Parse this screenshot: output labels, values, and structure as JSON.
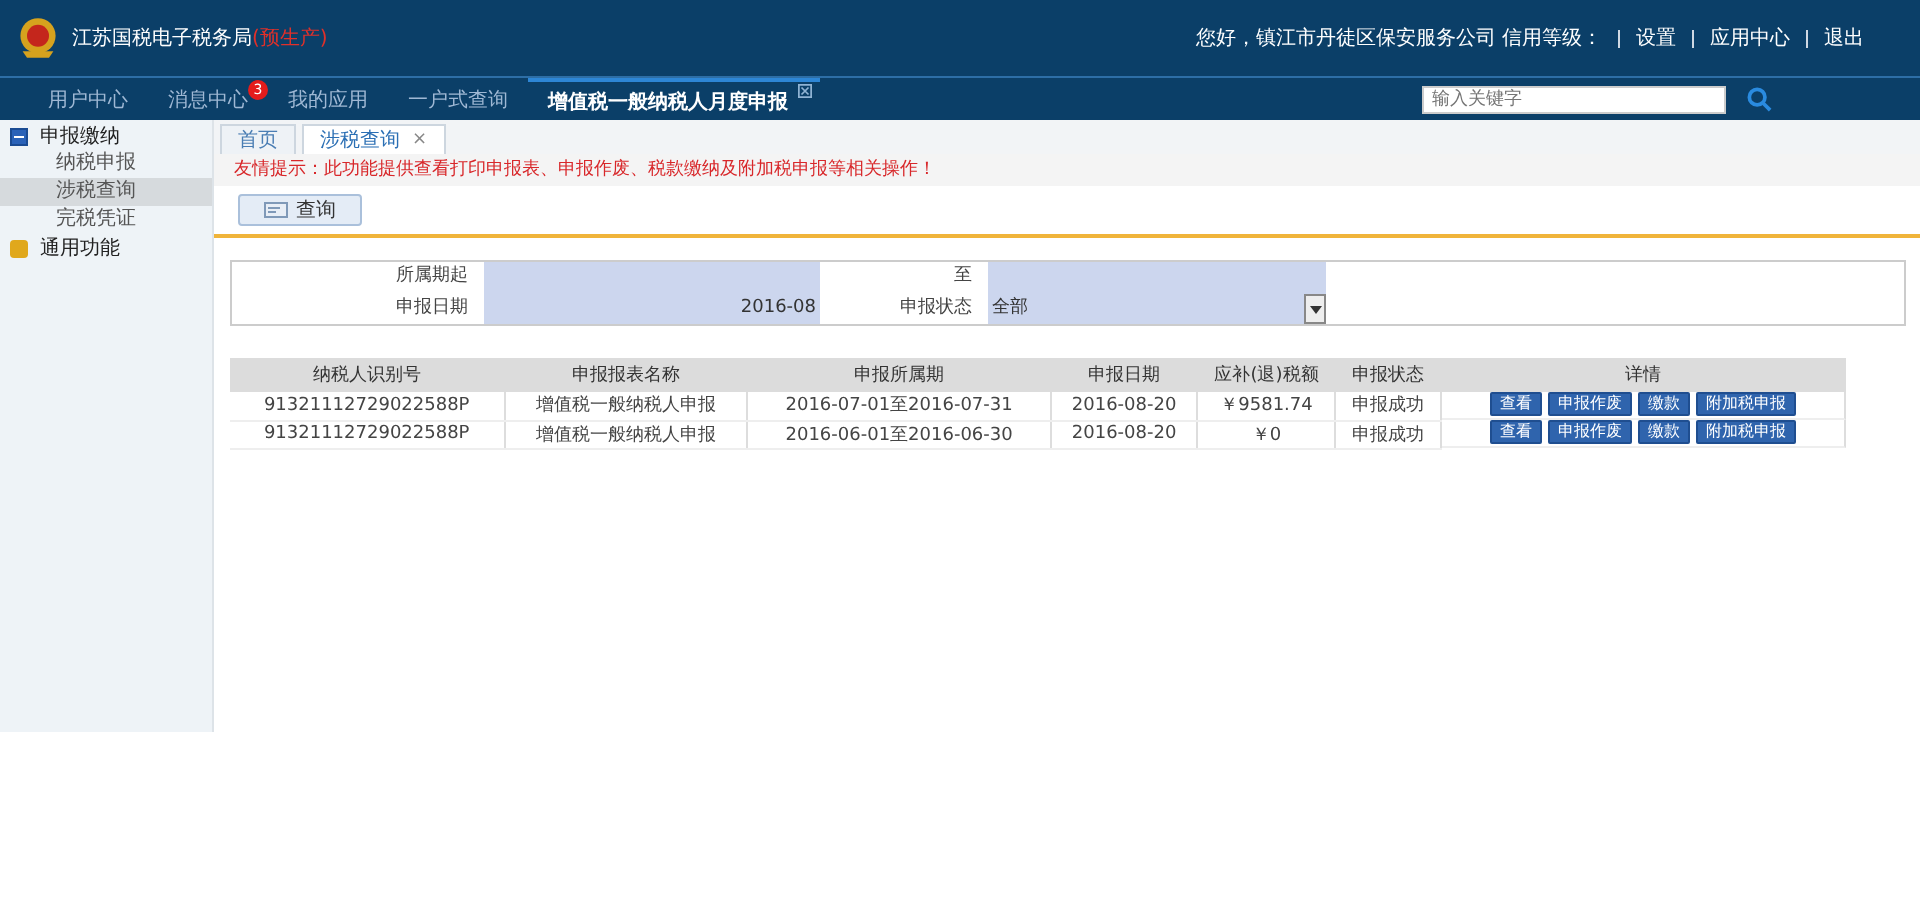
{
  "header": {
    "title": "江苏国税电子税务局",
    "title_suffix": "(预生产)",
    "greeting": "您好，镇江市丹徒区保安服务公司 信用等级：",
    "links": [
      "设置",
      "应用中心",
      "退出"
    ]
  },
  "nav": [
    {
      "label": "用户中心",
      "selected": false
    },
    {
      "label": "消息中心",
      "selected": false,
      "badge": "3"
    },
    {
      "label": "我的应用",
      "selected": false
    },
    {
      "label": "一户式查询",
      "selected": false
    },
    {
      "label": "增值税一般纳税人月度申报",
      "selected": true,
      "closable": true
    }
  ],
  "search": {
    "placeholder": "输入关键字"
  },
  "sidebar": {
    "items": [
      {
        "label": "申报缴纳",
        "expanded": true,
        "children": [
          {
            "label": "纳税申报",
            "selected": false
          },
          {
            "label": "涉税查询",
            "selected": true
          },
          {
            "label": "完税凭证",
            "selected": false
          }
        ]
      },
      {
        "label": "通用功能",
        "expanded": false
      }
    ]
  },
  "tabs": [
    {
      "label": "首页",
      "selected": false
    },
    {
      "label": "涉税查询",
      "selected": true,
      "close": "×"
    }
  ],
  "notice": "友情提示：此功能提供查看打印申报表、申报作废、税款缴纳及附加税申报等相关操作！",
  "query_button": "查询",
  "form": {
    "period_label": "所属期起",
    "to_label": "至",
    "date_label": "申报日期",
    "date_value": "2016-08",
    "status_label": "申报状态",
    "status_value": "全部"
  },
  "table": {
    "columns": [
      "纳税人识别号",
      "申报报表名称",
      "申报所属期",
      "申报日期",
      "应补(退)税额",
      "申报状态",
      "详情"
    ],
    "rows": [
      {
        "cells": [
          "91321112729022588P",
          "增值税一般纳税人申报",
          "2016-07-01至2016-07-31",
          "2016-08-20",
          "￥9581.74",
          "申报成功"
        ],
        "actions": [
          "查看",
          "申报作废",
          "缴款",
          "附加税申报"
        ]
      },
      {
        "cells": [
          "91321112729022588P",
          "增值税一般纳税人申报",
          "2016-06-01至2016-06-30",
          "2016-08-20",
          "￥0",
          "申报成功"
        ],
        "actions": [
          "查看",
          "申报作废",
          "缴款",
          "附加税申报"
        ]
      }
    ]
  }
}
